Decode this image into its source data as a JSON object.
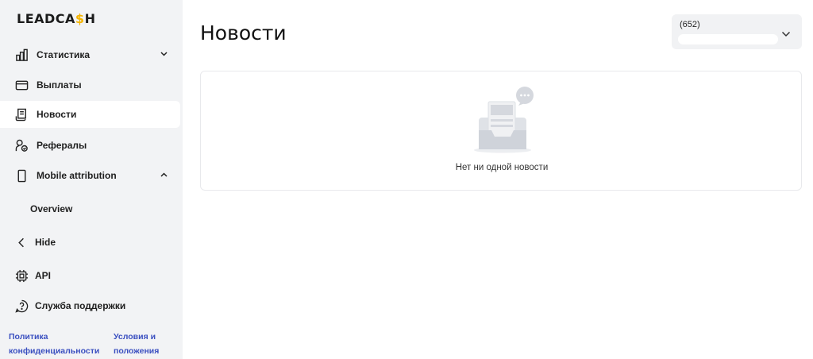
{
  "brand": {
    "logo_before": "LEADCA",
    "logo_accent": "$",
    "logo_after": "H"
  },
  "sidebar": {
    "items": [
      {
        "label": "Статистика",
        "icon": "bar-chart-icon",
        "chevron": "down"
      },
      {
        "label": "Выплаты",
        "icon": "credit-card-icon"
      },
      {
        "label": "Новости",
        "icon": "news-icon",
        "active": true
      },
      {
        "label": "Рефералы",
        "icon": "referral-user-icon"
      },
      {
        "label": "Mobile attribution",
        "icon": "mobile-phone-icon",
        "chevron": "up"
      },
      {
        "label": "Overview"
      },
      {
        "label": "Hide",
        "icon": "chevron-left-icon"
      },
      {
        "label": "API",
        "icon": "chip-icon"
      },
      {
        "label": "Служба поддержки",
        "icon": "help-circle-icon"
      }
    ],
    "footer": {
      "privacy": "Политика конфиденциальности",
      "terms": "Условия и положения"
    }
  },
  "main": {
    "title": "Новости",
    "account_select": {
      "value": "(652)"
    },
    "empty_state": {
      "text": "Нет ни одной новости"
    }
  },
  "colors": {
    "accent": "#f5b400",
    "sidebar_bg": "#f2f3f5",
    "link": "#3a4fc0"
  }
}
